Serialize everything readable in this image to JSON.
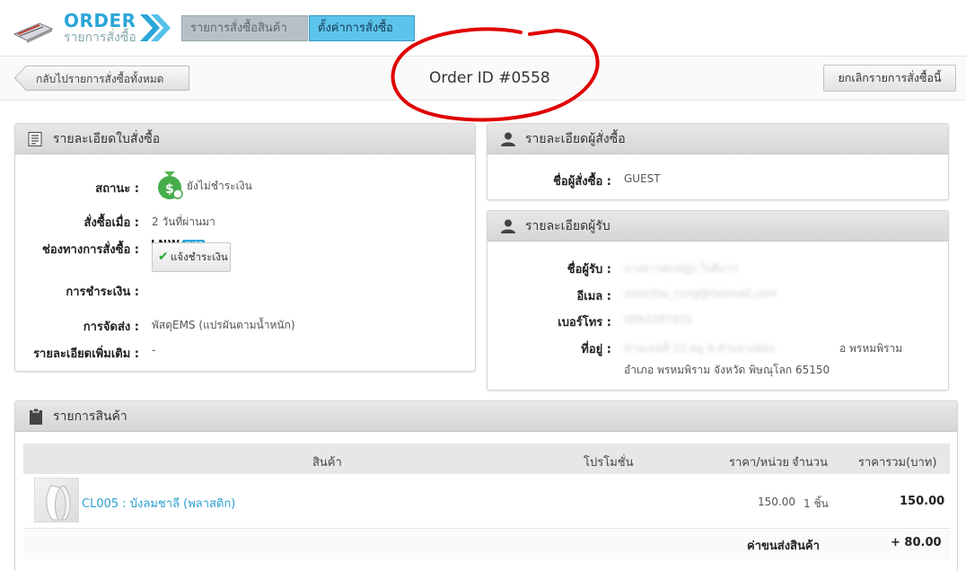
{
  "header": {
    "logo_title": "ORDER",
    "logo_subtitle": "รายการสั่งซื้อ",
    "tabs": [
      {
        "label": "รายการสั่งซื้อสินค้า"
      },
      {
        "label": "ตั้งค่าการสั่งซื้อ"
      }
    ]
  },
  "actionbar": {
    "back_label": "กลับไปรายการสั่งซื้อทั้งหมด",
    "order_id": "Order ID #0558",
    "cancel_label": "ยกเลิกรายการสั่งซื้อนี้"
  },
  "order_panel": {
    "title": "รายละเอียดใบสั่งซื้อ",
    "status_label": "สถานะ :",
    "status_value": "ยังไม่ชำระเงิน",
    "ordered_label": "สั่งซื้อเมื่อ :",
    "ordered_value": "2 วันที่ผ่านมา",
    "channel_label": "ช่องทางการสั่งซื้อ :",
    "channel_value": "LNW SHOP",
    "payment_label": "การชำระเงิน :",
    "payment_button": "แจ้งชำระเงิน",
    "shipping_label": "การจัดส่ง :",
    "shipping_value": "พัสดุEMS (แปรผันตามน้ำหนัก)",
    "extra_label": "รายละเอียดเพิ่มเติม :",
    "extra_value": "-"
  },
  "buyer_panel": {
    "title": "รายละเอียดผู้สั่งซื้อ",
    "name_label": "ชื่อผู้สั่งซื้อ :",
    "name_value": "GUEST"
  },
  "receiver_panel": {
    "title": "รายละเอียดผู้รับ",
    "name_label": "ชื่อผู้รับ :",
    "name_value": "นางสาวสมหญิง ใจดีมาก",
    "email_label": "อีเมล :",
    "email_value": "somchai_rung@hotmail.com",
    "phone_label": "เบอร์โทร :",
    "phone_value": "0893287915",
    "address_label": "ที่อยู่ :",
    "address_line1_hidden": "บ้านเลขที่ 12 หมู่ 4 ตำบลวงฆ้อง",
    "address_line1_visible": "อ พรหมพิราม",
    "address_line2": "อำเภอ พรหมพิราม  จังหวัด พิษณุโลก  65150"
  },
  "items_panel": {
    "title": "รายการสินค้า",
    "columns": [
      "สินค้า",
      "โปรโมชั่น",
      "ราคา/หน่วย",
      "จำนวน",
      "ราคารวม(บาท)"
    ],
    "rows": [
      {
        "product": "CL005 : บังลมชาลี (พลาสติก)",
        "unit_price": "150.00",
        "qty": "1 ชิ้น",
        "total": "150.00"
      }
    ],
    "shipping_label": "ค่าขนส่งสินค้า",
    "shipping_value": "+ 80.00"
  },
  "colors": {
    "accent": "#2aa6d8",
    "active_tab": "#5cc3ea",
    "annotation": "#e00000",
    "status_icon": "#3fae49"
  }
}
